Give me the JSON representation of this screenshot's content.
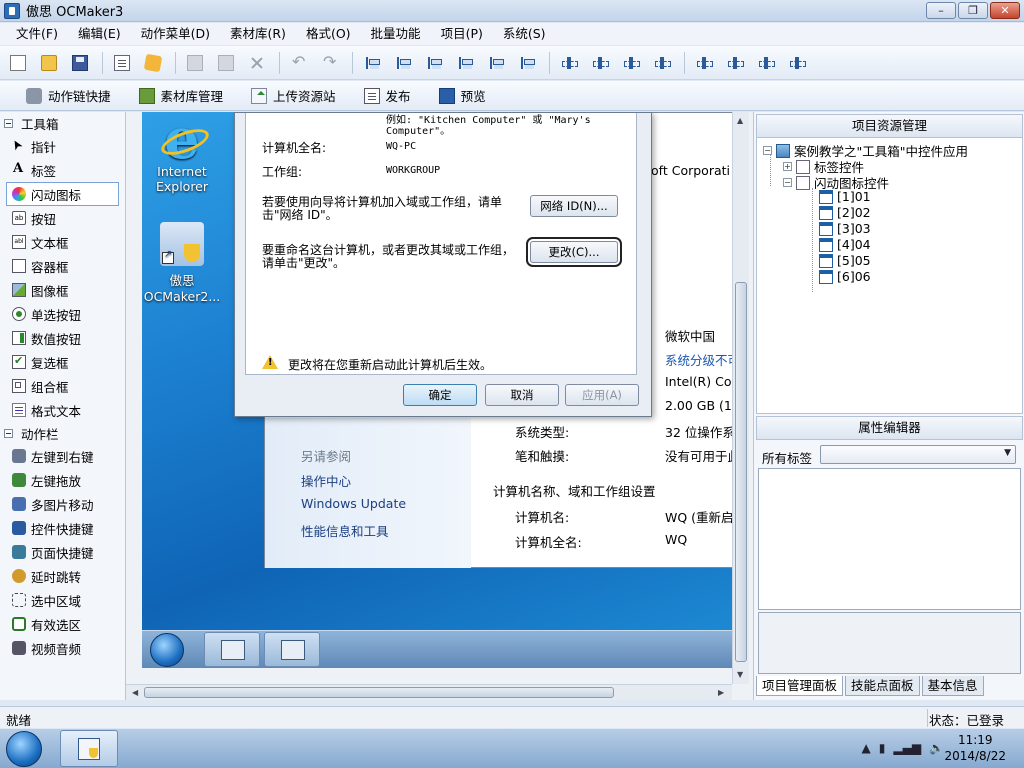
{
  "window": {
    "title": "傲思 OCMaker3"
  },
  "menu": [
    "文件(F)",
    "编辑(E)",
    "动作菜单(D)",
    "素材库(R)",
    "格式(O)",
    "批量功能",
    "项目(P)",
    "系统(S)"
  ],
  "toolbar2": {
    "action_chain_label": "动作链快捷",
    "library_label": "素材库管理",
    "upload_label": "上传资源站",
    "publish_label": "发布",
    "preview_label": "预览"
  },
  "toolbox": {
    "title": "工具箱",
    "items": [
      {
        "label": "指针",
        "icon": "pointer-icon"
      },
      {
        "label": "标签",
        "icon": "label-icon"
      },
      {
        "label": "闪动图标",
        "icon": "flash-icon"
      },
      {
        "label": "按钮",
        "icon": "button-icon"
      },
      {
        "label": "文本框",
        "icon": "textbox-icon"
      },
      {
        "label": "容器框",
        "icon": "container-icon"
      },
      {
        "label": "图像框",
        "icon": "image-icon"
      },
      {
        "label": "单选按钮",
        "icon": "radio-icon"
      },
      {
        "label": "数值按钮",
        "icon": "spin-icon"
      },
      {
        "label": "复选框",
        "icon": "checkbox-icon"
      },
      {
        "label": "组合框",
        "icon": "combo-icon"
      },
      {
        "label": "格式文本",
        "icon": "richtext-icon"
      }
    ],
    "action_title": "动作栏",
    "actions": [
      "左键到右键",
      "左键拖放",
      "多图片移动",
      "控件快捷键",
      "页面快捷键",
      "延时跳转",
      "选中区域",
      "有效选区",
      "视频音频"
    ]
  },
  "stage": {
    "desktop_icons": [
      {
        "label": "Internet Explorer"
      },
      {
        "label": "傲思 OCMaker2..."
      }
    ],
    "dialog": {
      "example_line1": "例如: \"Kitchen Computer\" 或 \"Mary's",
      "example_line2": "Computer\"。",
      "full_name_label": "计算机全名:",
      "full_name_value": "WQ-PC",
      "workgroup_label": "工作组:",
      "workgroup_value": "WORKGROUP",
      "network_text1": "若要使用向导将计算机加入域或工作组，请单",
      "network_text2": "击\"网络 ID\"。",
      "network_id_button": "网络 ID(N)...",
      "rename_text1": "要重命名这台计算机，或者更改其域或工作组，",
      "rename_text2": "请单击\"更改\"。",
      "change_button": "更改(C)...",
      "warning_text": "更改将在您重新启动此计算机后生效。",
      "ok_button": "确定",
      "cancel_button": "取消",
      "apply_button": "应用(A)"
    },
    "system": {
      "ms_corp": "rosoft Corporati",
      "edition": "微软中国",
      "rating": "系统分级不可",
      "processor": "Intel(R) Cor",
      "memory": "2.00 GB (1.8",
      "type_label": "系统类型:",
      "type_value": "32 位操作系",
      "pen_label": "笔和触摸:",
      "pen_value": "没有可用于此",
      "see_also": "另请参阅",
      "links": [
        "操作中心",
        "Windows Update",
        "性能信息和工具"
      ],
      "section_heading": "计算机名称、域和工作组设置",
      "comp_name_label": "计算机名:",
      "comp_name_value": "WQ (重新启",
      "comp_full_label": "计算机全名:",
      "comp_full_value": "WQ"
    }
  },
  "right": {
    "project_title": "项目资源管理",
    "tree_root": "案例教学之\"工具箱\"中控件应用",
    "tree_folder1": "标签控件",
    "tree_folder2": "闪动图标控件",
    "tree_pages": [
      "[1]01",
      "[2]02",
      "[3]03",
      "[4]04",
      "[5]05",
      "[6]06"
    ],
    "property_title": "属性编辑器",
    "all_tags_label": "所有标签",
    "tabs": [
      "项目管理面板",
      "技能点面板",
      "基本信息"
    ]
  },
  "status": {
    "left": "就绪",
    "right": "状态：已登录"
  },
  "clock": {
    "time": "11:19",
    "date": "2014/8/22"
  }
}
